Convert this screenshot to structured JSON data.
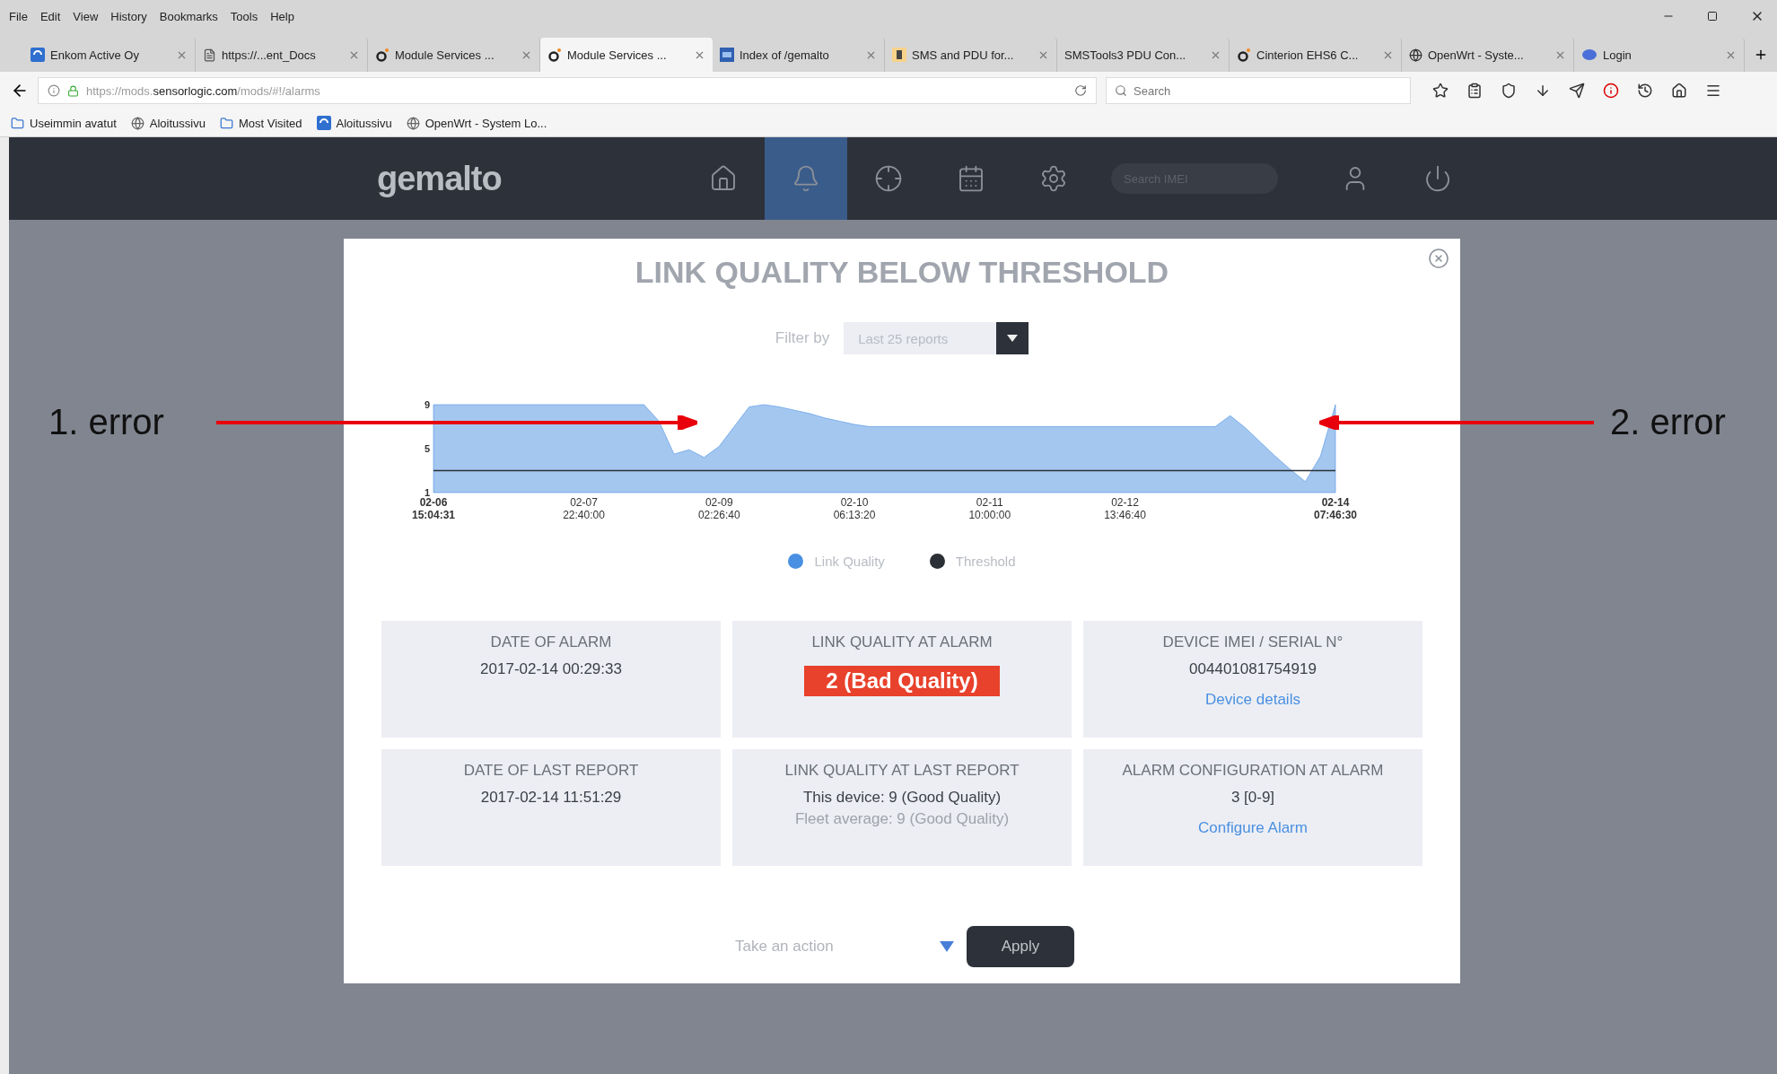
{
  "browser": {
    "menu": [
      "File",
      "Edit",
      "View",
      "History",
      "Bookmarks",
      "Tools",
      "Help"
    ],
    "tabs": [
      {
        "label": "Enkom Active Oy",
        "kind": "site",
        "selected": false
      },
      {
        "label": "https://...ent_Docs",
        "kind": "doc",
        "selected": false
      },
      {
        "label": "Module Services ...",
        "kind": "ring",
        "selected": false
      },
      {
        "label": "Module Services ...",
        "kind": "ring",
        "selected": true
      },
      {
        "label": "Index of /gemalto",
        "kind": "index",
        "selected": false
      },
      {
        "label": "SMS and PDU for...",
        "kind": "letter",
        "selected": false
      },
      {
        "label": "SMSTools3 PDU Con...",
        "kind": "plain",
        "selected": false
      },
      {
        "label": "Cinterion EHS6 C...",
        "kind": "ring",
        "selected": false
      },
      {
        "label": "OpenWrt - Syste...",
        "kind": "globe",
        "selected": false
      },
      {
        "label": "Login",
        "kind": "oval",
        "selected": false
      }
    ],
    "url": "https://mods.**sensorlogic.com**/mods/#!/alarms",
    "search": {
      "placeholder": "Search"
    },
    "bookmarks": [
      {
        "label": "Useimmin avatut",
        "kind": "folder"
      },
      {
        "label": "Aloitussivu",
        "kind": "globe"
      },
      {
        "label": "Most Visited",
        "kind": "folder"
      },
      {
        "label": "Aloitussivu",
        "kind": "site"
      },
      {
        "label": "OpenWrt - System Lo...",
        "kind": "globe"
      }
    ]
  },
  "app": {
    "logo": "gemalto",
    "nav": [
      {
        "kind": "home",
        "selected": false
      },
      {
        "kind": "bell",
        "selected": true
      },
      {
        "kind": "crosshair",
        "selected": false
      },
      {
        "kind": "calendar",
        "selected": false
      },
      {
        "kind": "gear",
        "selected": false
      }
    ],
    "search": {
      "placeholder": "Search IMEI"
    }
  },
  "modal": {
    "title": "LINK QUALITY BELOW THRESHOLD",
    "filter": {
      "label": "Filter by",
      "value": "Last 25 reports"
    },
    "chart_data": {
      "type": "area",
      "ylim": [
        1,
        9
      ],
      "yticks": [
        1,
        5,
        9
      ],
      "categories": [
        "02-06 15:04:31",
        null,
        null,
        null,
        null,
        null,
        null,
        null,
        null,
        null,
        "02-07 22:40:00",
        null,
        null,
        null,
        null,
        null,
        null,
        null,
        null,
        "02-09 02:26:40",
        null,
        null,
        null,
        null,
        null,
        null,
        null,
        null,
        "02-10 06:13:20",
        null,
        null,
        null,
        null,
        null,
        null,
        null,
        null,
        "02-11 10:00:00",
        null,
        null,
        null,
        null,
        null,
        null,
        null,
        null,
        "02-12 13:46:40",
        null,
        null,
        null,
        null,
        null,
        null,
        null,
        null,
        null,
        null,
        null,
        null,
        null,
        "02-14 07:46:30"
      ],
      "series": [
        {
          "name": "Link Quality",
          "type": "area",
          "color": "#4a90e2",
          "values": [
            9,
            9,
            9,
            9,
            9,
            9,
            9,
            9,
            9,
            9,
            9,
            9,
            9,
            9,
            9,
            7.5,
            4.5,
            4.9,
            4.2,
            5.2,
            7.0,
            8.8,
            9,
            8.8,
            8.5,
            8.2,
            7.8,
            7.5,
            7.2,
            7,
            7,
            7,
            7,
            7,
            7,
            7,
            7,
            7,
            7,
            7,
            7,
            7,
            7,
            7,
            7,
            7,
            7,
            7,
            7,
            7,
            7,
            7,
            7,
            8.0,
            6.9,
            5.6,
            4.3,
            3.1,
            2,
            4.3,
            9
          ]
        },
        {
          "name": "Threshold",
          "type": "line",
          "color": "#2b2f36",
          "values": [
            3,
            3,
            3,
            3,
            3,
            3,
            3,
            3,
            3,
            3,
            3,
            3,
            3,
            3,
            3,
            3,
            3,
            3,
            3,
            3,
            3,
            3,
            3,
            3,
            3,
            3,
            3,
            3,
            3,
            3,
            3,
            3,
            3,
            3,
            3,
            3,
            3,
            3,
            3,
            3,
            3,
            3,
            3,
            3,
            3,
            3,
            3,
            3,
            3,
            3,
            3,
            3,
            3,
            3,
            3,
            3,
            3,
            3,
            3,
            3,
            3
          ]
        }
      ]
    },
    "cards": [
      {
        "label": "DATE OF ALARM",
        "lines": [
          {
            "kind": "value",
            "text": "2017-02-14 00:29:33"
          }
        ]
      },
      {
        "label": "LINK QUALITY AT ALARM",
        "lines": [
          {
            "kind": "badge",
            "text": "2 (Bad Quality)"
          }
        ]
      },
      {
        "label": "DEVICE IMEI / SERIAL N°",
        "lines": [
          {
            "kind": "value",
            "text": "004401081754919"
          },
          {
            "kind": "link",
            "text": "Device details"
          }
        ]
      },
      {
        "label": "DATE OF LAST REPORT",
        "lines": [
          {
            "kind": "value",
            "text": "2017-02-14 11:51:29"
          }
        ]
      },
      {
        "label": "LINK QUALITY AT LAST REPORT",
        "lines": [
          {
            "kind": "value",
            "text": "This device: 9 (Good Quality)"
          },
          {
            "kind": "muted",
            "text": "Fleet average: 9 (Good Quality)"
          }
        ]
      },
      {
        "label": "ALARM CONFIGURATION AT ALARM",
        "lines": [
          {
            "kind": "value",
            "text": "3 [0-9]"
          },
          {
            "kind": "link",
            "text": "Configure Alarm"
          }
        ]
      }
    ],
    "action": {
      "placeholder": "Take an action",
      "button": "Apply"
    }
  },
  "annotations": [
    {
      "label": "1. error"
    },
    {
      "label": "2. error"
    }
  ]
}
